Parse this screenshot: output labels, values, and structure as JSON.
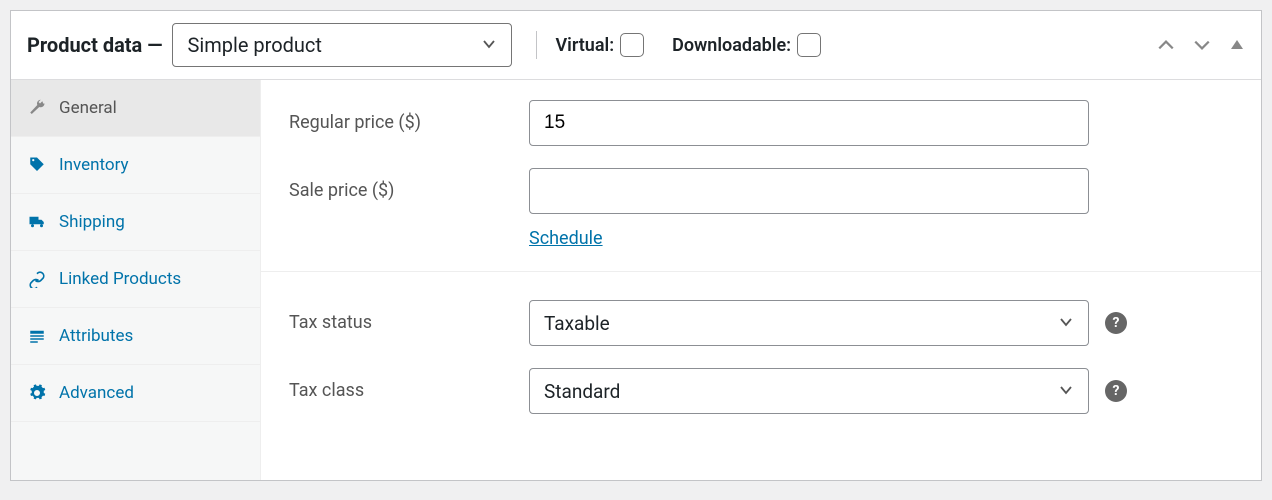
{
  "header": {
    "title": "Product data —",
    "product_type": "Simple product",
    "virtual_label": "Virtual:",
    "downloadable_label": "Downloadable:"
  },
  "sidebar": {
    "tabs": [
      {
        "label": "General"
      },
      {
        "label": "Inventory"
      },
      {
        "label": "Shipping"
      },
      {
        "label": "Linked Products"
      },
      {
        "label": "Attributes"
      },
      {
        "label": "Advanced"
      }
    ]
  },
  "general": {
    "regular_price_label": "Regular price ($)",
    "regular_price_value": "15",
    "sale_price_label": "Sale price ($)",
    "sale_price_value": "",
    "schedule_label": "Schedule",
    "tax_status_label": "Tax status",
    "tax_status_value": "Taxable",
    "tax_class_label": "Tax class",
    "tax_class_value": "Standard",
    "help_char": "?"
  }
}
